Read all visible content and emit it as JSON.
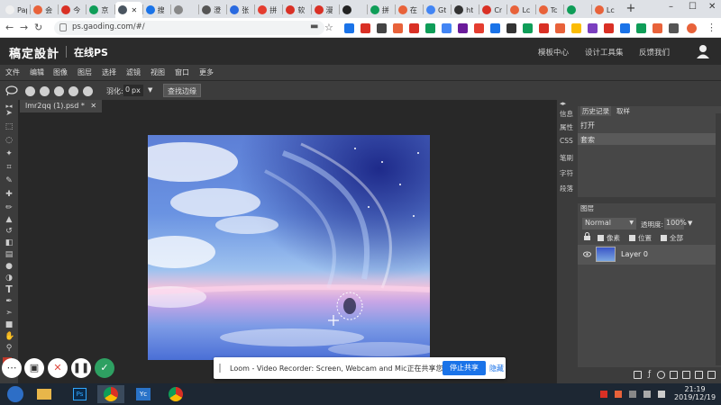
{
  "browser": {
    "tabs": [
      {
        "label": "Papal",
        "color": "#f0f0f0"
      },
      {
        "label": "会",
        "color": "#e8623a"
      },
      {
        "label": "今",
        "color": "#d93025"
      },
      {
        "label": "京",
        "color": "#0f9d58"
      },
      {
        "label": "",
        "color": "#4a5560",
        "active": true
      },
      {
        "label": "搜",
        "color": "#1a73e8"
      },
      {
        "label": "",
        "color": "#888888"
      },
      {
        "label": "澄",
        "color": "#555555"
      },
      {
        "label": "张",
        "color": "#2a6ae0"
      },
      {
        "label": "拼",
        "color": "#e43d30"
      },
      {
        "label": "软",
        "color": "#d93025"
      },
      {
        "label": "漫",
        "color": "#d93025"
      },
      {
        "label": "",
        "color": "#222222"
      },
      {
        "label": "拼",
        "color": "#0f9d58"
      },
      {
        "label": "在",
        "color": "#e8623a"
      },
      {
        "label": "Gt",
        "color": "#4285f4"
      },
      {
        "label": "ht",
        "color": "#333333"
      },
      {
        "label": "Cr",
        "color": "#d93025"
      },
      {
        "label": "Lc",
        "color": "#e8623a"
      },
      {
        "label": "Tc",
        "color": "#e8623a"
      },
      {
        "label": "",
        "color": "#0f9d58"
      },
      {
        "label": "Lc",
        "color": "#e8623a"
      }
    ],
    "new_tab": "+",
    "url": "ps.gaoding.com/#/",
    "window_controls": [
      "–",
      "☐",
      "✕"
    ]
  },
  "app": {
    "logo": "稿定設計",
    "subtitle": "在线PS",
    "links": [
      "模板中心",
      "设计工具集",
      "反馈我们"
    ]
  },
  "menu": [
    "文件",
    "编辑",
    "图像",
    "图层",
    "选择",
    "滤镜",
    "视图",
    "窗口",
    "更多"
  ],
  "options": {
    "feather_label": "羽化:",
    "feather_value": "0",
    "feather_unit": "px",
    "edge_button": "查找边缘"
  },
  "document": {
    "tab_label": "lmr2qq (1).psd *",
    "tab_close": "✕"
  },
  "side_strip": [
    "信息",
    "属性",
    "CSS",
    "笔刷",
    "字符",
    "段落"
  ],
  "history": {
    "tabs": [
      "历史记录",
      "取样"
    ],
    "entries": [
      "打开",
      "套索"
    ]
  },
  "layers": {
    "tab": "图层",
    "blend_mode": "Normal",
    "opacity_label": "透明度:",
    "opacity_value": "100%",
    "lock_options": [
      "像素",
      "位置",
      "全部"
    ],
    "layer_name": "Layer 0"
  },
  "loom": {
    "message": "Loom - Video Recorder: Screen, Webcam and Mic正在共享您的屏幕。",
    "stop_button": "停止共享",
    "hide_link": "隐藏"
  },
  "taskbar": {
    "time": "21:19",
    "date": "2019/12/19"
  },
  "colors": {
    "accent": "#1a73e8",
    "app_bg": "#3c3c3c",
    "header_bg": "#2b2b2b"
  }
}
